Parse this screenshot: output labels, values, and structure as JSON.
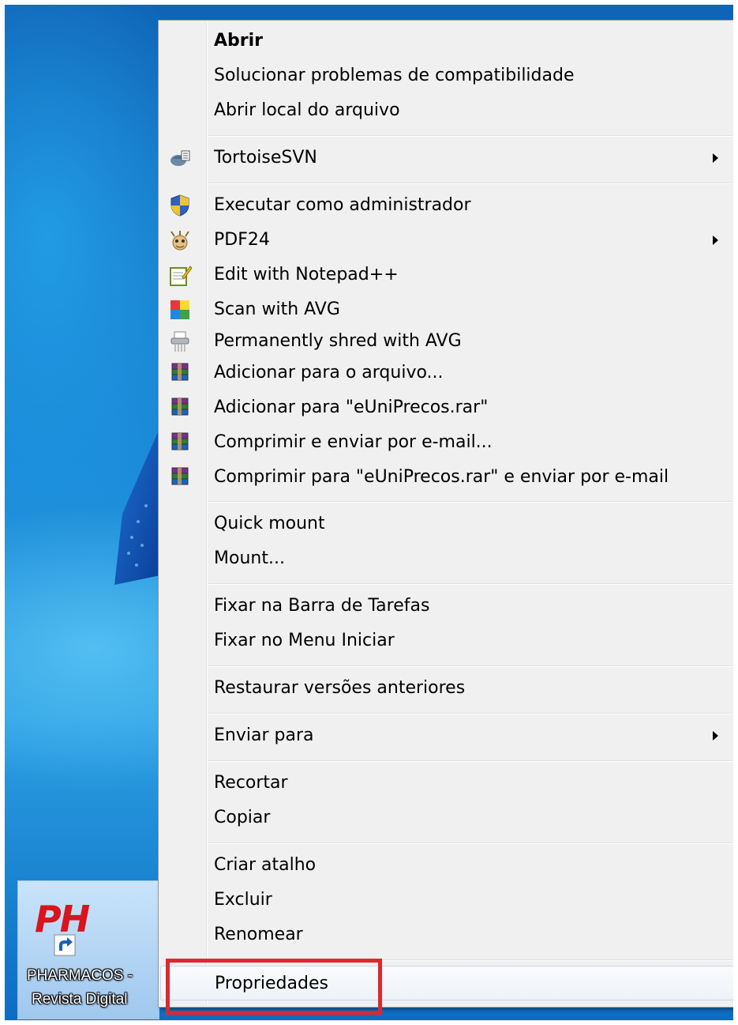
{
  "desktop_icon": {
    "logo_text": "PH",
    "label_line1": "PHARMACOS -",
    "label_line2": "Revista Digital"
  },
  "context_menu": {
    "items": [
      {
        "label": "Abrir",
        "bold": true,
        "icon": "",
        "submenu": false
      },
      {
        "label": "Solucionar problemas de compatibilidade",
        "icon": "",
        "submenu": false
      },
      {
        "label": "Abrir local do arquivo",
        "icon": "",
        "submenu": false
      },
      {
        "label": "TortoiseSVN",
        "icon": "tortoise-svn-icon",
        "submenu": true
      },
      {
        "label": "Executar como administrador",
        "icon": "uac-shield-icon",
        "submenu": false
      },
      {
        "label": "PDF24",
        "icon": "pdf24-icon",
        "submenu": true
      },
      {
        "label": "Edit with Notepad++",
        "icon": "notepad-plus-plus-icon",
        "submenu": false
      },
      {
        "label": "Scan with AVG",
        "icon": "avg-icon",
        "submenu": false
      },
      {
        "label": "Permanently shred with AVG",
        "icon": "shredder-icon",
        "submenu": false
      },
      {
        "label": "Adicionar para o arquivo...",
        "icon": "winrar-icon",
        "submenu": false
      },
      {
        "label": "Adicionar para \"eUniPrecos.rar\"",
        "icon": "winrar-icon",
        "submenu": false
      },
      {
        "label": "Comprimir e enviar por e-mail...",
        "icon": "winrar-icon",
        "submenu": false
      },
      {
        "label": "Comprimir para \"eUniPrecos.rar\" e enviar por e-mail",
        "icon": "winrar-icon",
        "submenu": false
      },
      {
        "label": "Quick mount",
        "icon": "",
        "submenu": false
      },
      {
        "label": "Mount...",
        "icon": "",
        "submenu": false
      },
      {
        "label": "Fixar na Barra de Tarefas",
        "icon": "",
        "submenu": false
      },
      {
        "label": "Fixar no Menu Iniciar",
        "icon": "",
        "submenu": false
      },
      {
        "label": "Restaurar versões anteriores",
        "icon": "",
        "submenu": false
      },
      {
        "label": "Enviar para",
        "icon": "",
        "submenu": true
      },
      {
        "label": "Recortar",
        "icon": "",
        "submenu": false
      },
      {
        "label": "Copiar",
        "icon": "",
        "submenu": false
      },
      {
        "label": "Criar atalho",
        "icon": "",
        "submenu": false
      },
      {
        "label": "Excluir",
        "icon": "",
        "submenu": false
      },
      {
        "label": "Renomear",
        "icon": "",
        "submenu": false
      },
      {
        "label": "Propriedades",
        "icon": "",
        "submenu": false,
        "hovered": true
      }
    ]
  },
  "colors": {
    "highlight_box": "#e0262f",
    "logo": "#d8141c",
    "menu_bg": "#f0f0f0"
  }
}
